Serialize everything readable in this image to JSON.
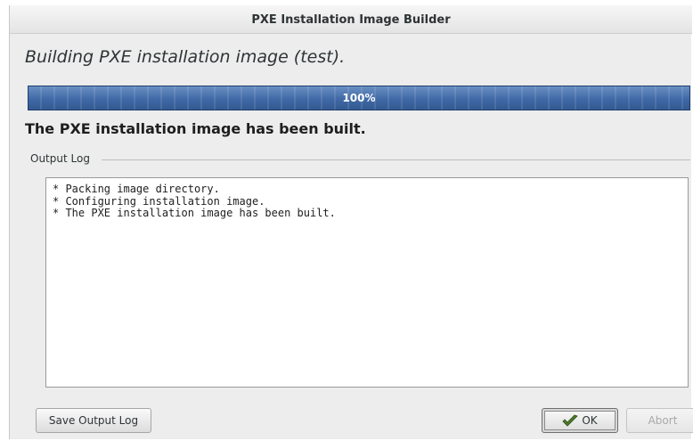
{
  "window": {
    "title": "PXE Installation Image Builder"
  },
  "heading": "Building PXE installation image (test).",
  "progress": {
    "value": 1.0,
    "label": "100%",
    "fill_color": "#3f69a6"
  },
  "status_message": "The PXE installation image has been built.",
  "output_log": {
    "label": "Output Log",
    "lines": [
      "* Packing image directory.",
      "* Configuring installation image.",
      "* The PXE installation image has been built."
    ]
  },
  "buttons": {
    "save_output_log": "Save Output Log",
    "ok": "OK",
    "abort": "Abort",
    "ok_icon": "check-icon"
  }
}
